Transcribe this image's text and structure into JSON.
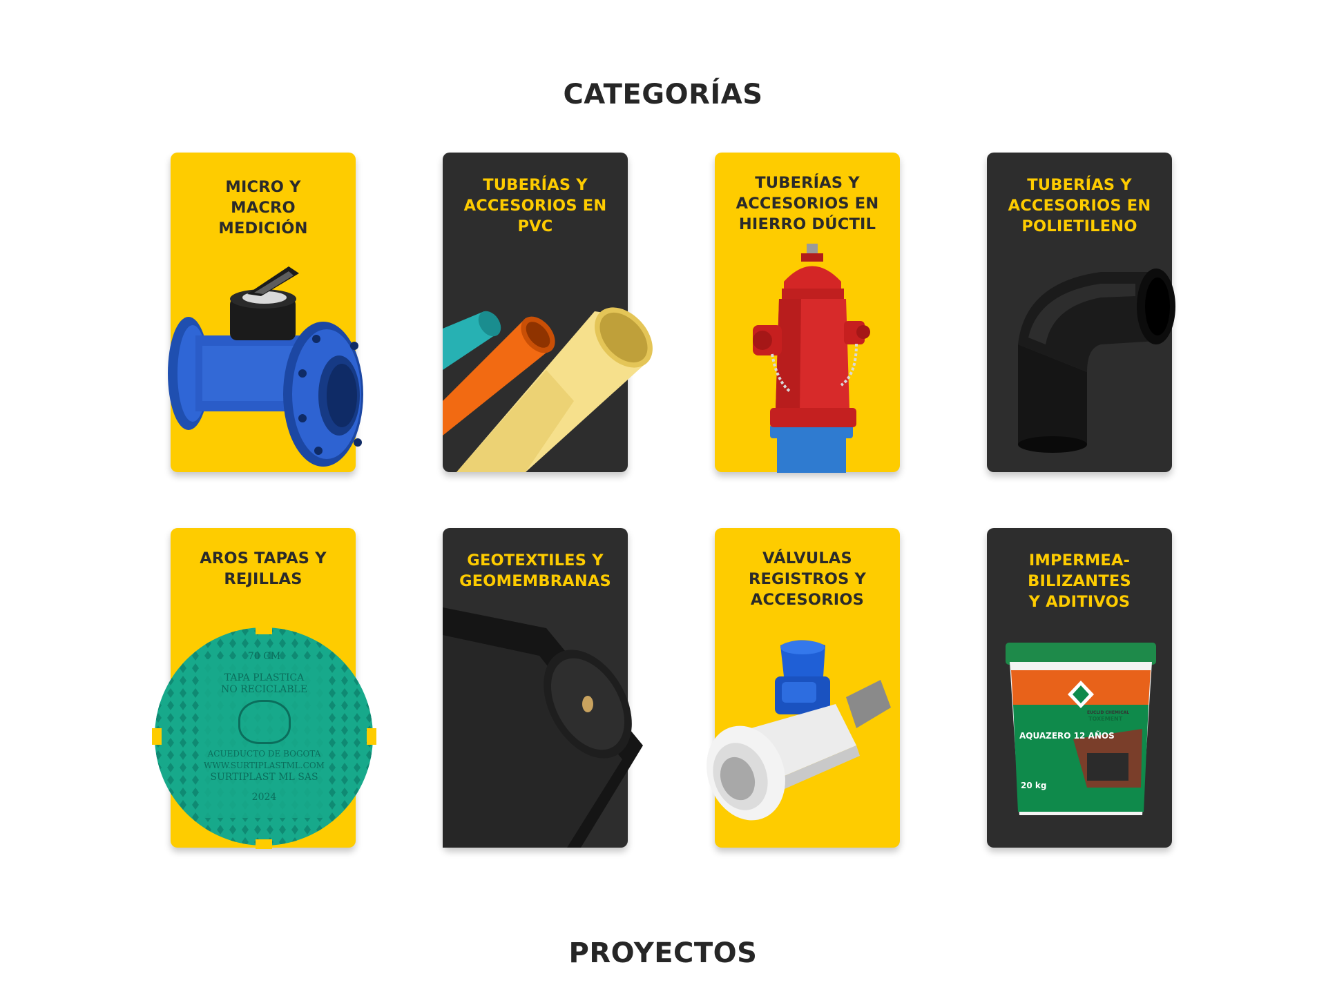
{
  "sections": {
    "categorias_title": "CATEGORÍAS",
    "proyectos_title": "PROYECTOS"
  },
  "colors": {
    "yellow": "#fecc00",
    "dark": "#2d2d2d",
    "heading": "#262626"
  },
  "categories": [
    {
      "title": "MICRO Y\nMACRO\nMEDICIÓN",
      "theme": "yellow",
      "image": "water-meter-image"
    },
    {
      "title": "TUBERÍAS Y\nACCESORIOS EN\nPVC",
      "theme": "dark",
      "image": "pvc-pipes-image"
    },
    {
      "title": "TUBERÍAS Y\nACCESORIOS EN\nHIERRO DÚCTIL",
      "theme": "yellow",
      "image": "fire-hydrant-image"
    },
    {
      "title": "TUBERÍAS Y\nACCESORIOS EN\nPOLIETILENO",
      "theme": "dark",
      "image": "polyethylene-elbow-image"
    },
    {
      "title": "AROS TAPAS Y\nREJILLAS",
      "theme": "yellow",
      "image": "manhole-cover-image",
      "cover_text": [
        "70 CM",
        "TAPA PLASTICA",
        "NO RECICLABLE",
        "ACUEDUCTO DE BOGOTA",
        "WWW.SURTIPLASTML.COM",
        "SURTIPLAST ML SAS",
        "2024"
      ]
    },
    {
      "title": "GEOTEXTILES Y\nGEOMEMBRANAS",
      "theme": "dark",
      "image": "geotextile-roll-image"
    },
    {
      "title": "VÁLVULAS\nREGISTROS Y\nACCESORIOS",
      "theme": "yellow",
      "image": "ball-valve-image"
    },
    {
      "title": "IMPERMEA-\nBILIZANTES\nY ADITIVOS",
      "theme": "dark",
      "image": "waterproofing-bucket-image",
      "bucket_text": {
        "brand": "TOXEMENT",
        "brand_sub": "EUCLID CHEMICAL",
        "product": "AQUAZERO 12 AÑOS",
        "weight": "20 kg"
      }
    }
  ]
}
